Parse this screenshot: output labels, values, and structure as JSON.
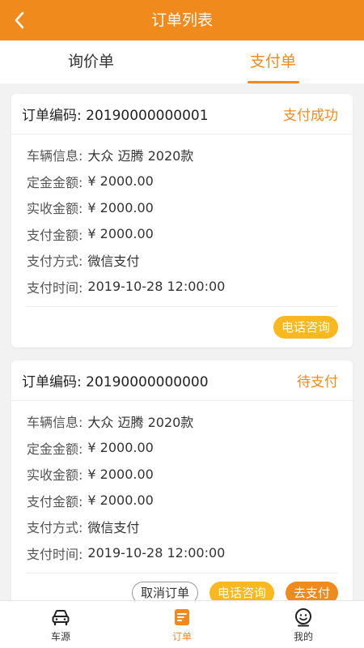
{
  "header": {
    "title": "订单列表"
  },
  "tabs": [
    {
      "label": "询价单"
    },
    {
      "label": "支付单"
    }
  ],
  "orders": [
    {
      "order_label": "订单编码: 20190000000001",
      "status": "支付成功",
      "fields": [
        {
          "key": "车辆信息:",
          "value": "大众 迈腾 2020款"
        },
        {
          "key": "定金金额:",
          "value": "¥ 2000.00"
        },
        {
          "key": "实收金额:",
          "value": "¥ 2000.00"
        },
        {
          "key": "支付金额:",
          "value": "¥ 2000.00"
        },
        {
          "key": "支付方式:",
          "value": "微信支付"
        },
        {
          "key": "支付时间:",
          "value": "2019-10-28 12:00:00"
        }
      ],
      "actions": {
        "phone": "电话咨询"
      }
    },
    {
      "order_label": "订单编码: 20190000000000",
      "status": "待支付",
      "fields": [
        {
          "key": "车辆信息:",
          "value": "大众 迈腾 2020款"
        },
        {
          "key": "定金金额:",
          "value": "¥ 2000.00"
        },
        {
          "key": "实收金额:",
          "value": "¥ 2000.00"
        },
        {
          "key": "支付金额:",
          "value": "¥ 2000.00"
        },
        {
          "key": "支付方式:",
          "value": "微信支付"
        },
        {
          "key": "支付时间:",
          "value": "2019-10-28 12:00:00"
        }
      ],
      "actions": {
        "cancel": "取消订单",
        "phone": "电话咨询",
        "pay": "去支付"
      }
    }
  ],
  "tabbar": [
    {
      "label": "车源",
      "icon": "car-icon"
    },
    {
      "label": "订单",
      "icon": "order-icon"
    },
    {
      "label": "我的",
      "icon": "profile-icon"
    }
  ],
  "colors": {
    "brand": "#f08a1c",
    "button_yellow": "#f9b81e"
  }
}
